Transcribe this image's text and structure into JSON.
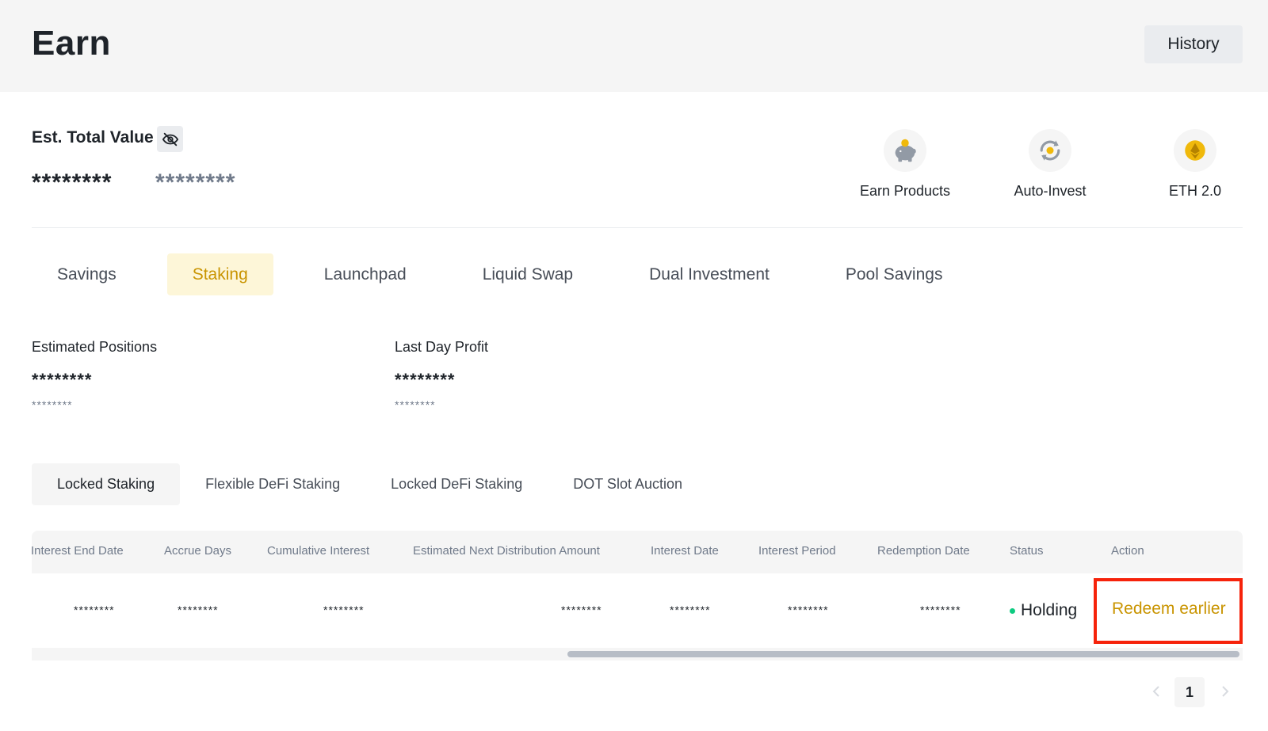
{
  "header": {
    "title": "Earn",
    "history_label": "History"
  },
  "summary": {
    "label": "Est. Total Value",
    "hide_icon": "eye-off-icon",
    "value_masked": "********",
    "fiat_masked": "********"
  },
  "shortcuts": [
    {
      "label": "Earn Products",
      "icon": "piggy-bank-icon"
    },
    {
      "label": "Auto-Invest",
      "icon": "auto-invest-icon"
    },
    {
      "label": "ETH 2.0",
      "icon": "ethereum-icon"
    }
  ],
  "main_tabs": [
    {
      "label": "Savings",
      "active": false
    },
    {
      "label": "Staking",
      "active": true
    },
    {
      "label": "Launchpad",
      "active": false
    },
    {
      "label": "Liquid Swap",
      "active": false
    },
    {
      "label": "Dual Investment",
      "active": false
    },
    {
      "label": "Pool Savings",
      "active": false
    }
  ],
  "stats": [
    {
      "label": "Estimated Positions",
      "value": "********",
      "sub": "********"
    },
    {
      "label": "Last Day Profit",
      "value": "********",
      "sub": "********"
    }
  ],
  "sub_tabs": [
    {
      "label": "Locked Staking",
      "active": true
    },
    {
      "label": "Flexible DeFi Staking",
      "active": false
    },
    {
      "label": "Locked DeFi Staking",
      "active": false
    },
    {
      "label": "DOT Slot Auction",
      "active": false
    }
  ],
  "table": {
    "columns": [
      "Interest End Date",
      "Accrue Days",
      "Cumulative Interest",
      "Estimated Next Distribution Amount",
      "Interest Date",
      "Interest Period",
      "Redemption Date",
      "Status",
      "Action"
    ],
    "row": {
      "interest_end_date": "********",
      "accrue_days": "********",
      "cumulative_interest": "********",
      "next_distribution": "********",
      "interest_date": "********",
      "interest_period": "********",
      "redemption_date": "********",
      "status": "Holding",
      "action": "Redeem earlier"
    }
  },
  "pagination": {
    "current_page": "1"
  },
  "colors": {
    "accent": "#c99400",
    "active_tab_bg": "#fdf6d8",
    "status_green": "#0ecb81",
    "highlight_red": "#f6230b"
  }
}
